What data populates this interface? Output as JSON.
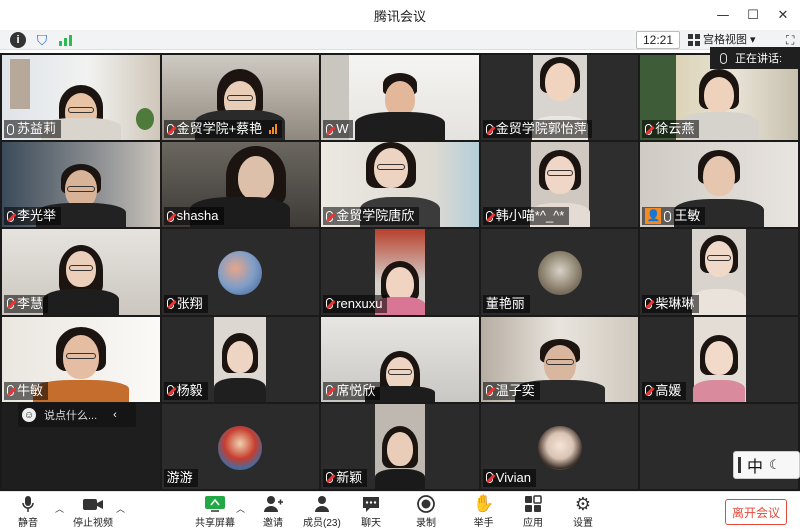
{
  "window": {
    "title": "腾讯会议"
  },
  "infobar": {
    "time": "12:21",
    "view_mode": "宫格视图"
  },
  "speaking": {
    "label": "正在讲话:"
  },
  "participants": [
    {
      "name": "苏益莉"
    },
    {
      "name": "金贸学院+蔡艳"
    },
    {
      "name": "W"
    },
    {
      "name": "金贸学院郭怡萍"
    },
    {
      "name": "徐云燕"
    },
    {
      "name": "李光举"
    },
    {
      "name": "shasha"
    },
    {
      "name": "金贸学院唐欣"
    },
    {
      "name": "韩小喵*^_^*"
    },
    {
      "name": "王敏"
    },
    {
      "name": "李慧"
    },
    {
      "name": "张翔"
    },
    {
      "name": "renxuxu"
    },
    {
      "name": "董艳丽"
    },
    {
      "name": "柴琳琳"
    },
    {
      "name": "牛敏"
    },
    {
      "name": "杨毅"
    },
    {
      "name": "席悦欣"
    },
    {
      "name": "温子奕"
    },
    {
      "name": "高媛"
    },
    {
      "name": ""
    },
    {
      "name": "游游"
    },
    {
      "name": "新颖"
    },
    {
      "name": "Vivian"
    },
    {
      "name": ""
    }
  ],
  "chat_hint": {
    "placeholder": "说点什么..."
  },
  "ime": {
    "mode": "中"
  },
  "toolbar": {
    "mute": "静音",
    "stop_video": "停止视频",
    "share_screen": "共享屏幕",
    "invite": "邀请",
    "members": "成员(23)",
    "chat": "聊天",
    "record": "录制",
    "raise_hand": "举手",
    "apps": "应用",
    "settings": "设置",
    "leave": "离开会议"
  },
  "colors": {
    "accent_orange": "#f58a1f",
    "leave_red": "#e64a3b",
    "signal_green": "#2dbb54",
    "share_green": "#22a845"
  }
}
